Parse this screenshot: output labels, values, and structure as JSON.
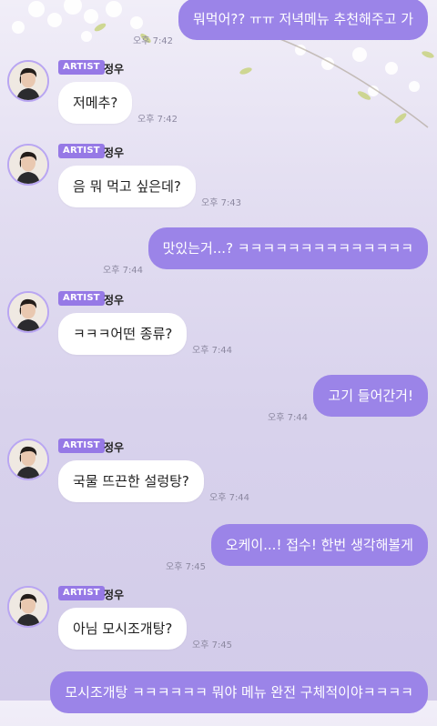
{
  "chat": {
    "artist_badge": "ARTIST",
    "artist_name": "정우",
    "messages": [
      {
        "side": "out",
        "text": "뭐먹어?? ㅠㅠ 저녁메뉴 추천해주고 가",
        "time": "오후 7:42"
      },
      {
        "side": "in",
        "text": "저메추?",
        "time": "오후 7:42"
      },
      {
        "side": "in",
        "text": "음 뭐 먹고 싶은데?",
        "time": "오후 7:43"
      },
      {
        "side": "out",
        "text": "맛있는거...? ㅋㅋㅋㅋㅋㅋㅋㅋㅋㅋㅋㅋㅋㅋ",
        "time": "오후 7:44"
      },
      {
        "side": "in",
        "text": "ㅋㅋㅋ어떤 종류?",
        "time": "오후 7:44"
      },
      {
        "side": "out",
        "text": "고기 들어간거!",
        "time": "오후 7:44"
      },
      {
        "side": "in",
        "text": "국물 뜨끈한 설렁탕?",
        "time": "오후 7:44"
      },
      {
        "side": "out",
        "text": "오케이...! 접수! 한번 생각해볼게",
        "time": "오후 7:45"
      },
      {
        "side": "in",
        "text": "아님 모시조개탕?",
        "time": "오후 7:45"
      },
      {
        "side": "out",
        "text": "모시조개탕 ㅋㅋㅋㅋㅋㅋ 뭐야 메뉴 완전 구체적이야ㅋㅋㅋㅋ",
        "time": ""
      }
    ]
  },
  "colors": {
    "outgoing_bubble": "#9b84e8",
    "incoming_bubble": "#ffffff",
    "badge": "#9679e6",
    "avatar_border": "#b9a6f2"
  }
}
